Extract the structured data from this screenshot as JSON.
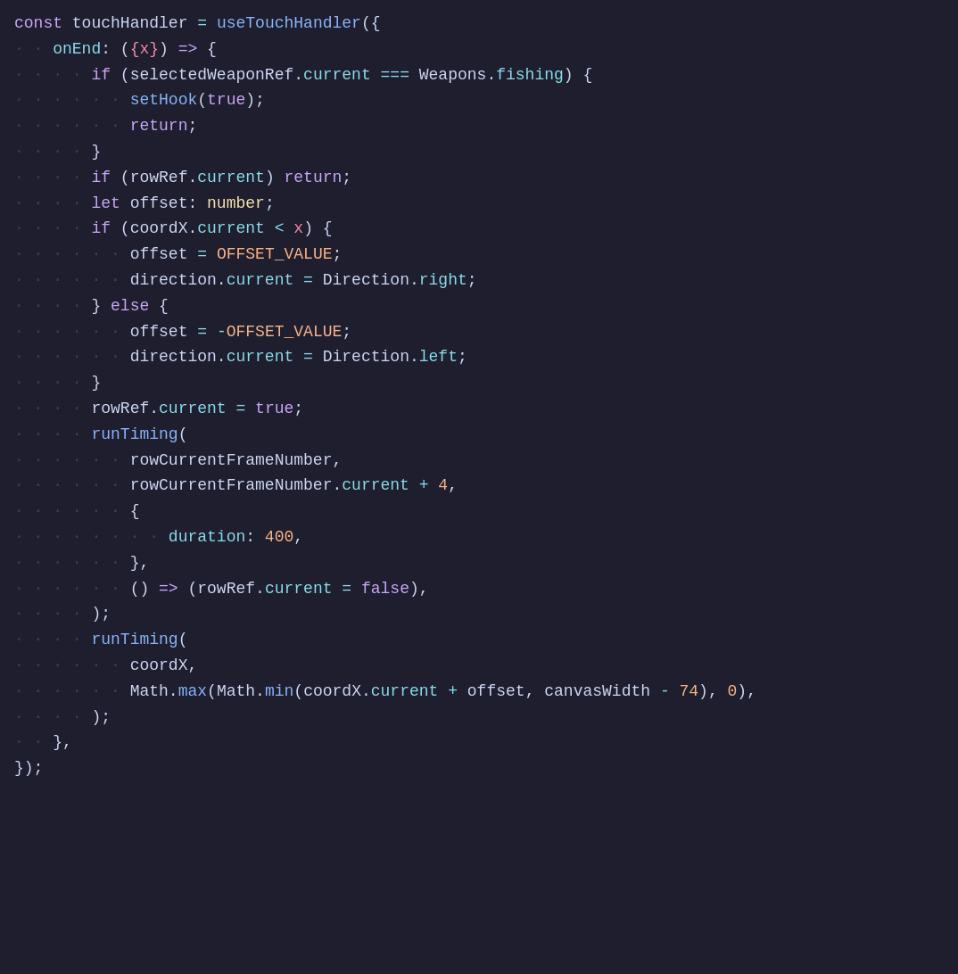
{
  "editor": {
    "background": "#1e1e2e",
    "lines": [
      {
        "indent": 0,
        "tokens": [
          {
            "t": "kw",
            "v": "const"
          },
          {
            "t": "var",
            "v": " touchHandler "
          },
          {
            "t": "eq",
            "v": "="
          },
          {
            "t": "var",
            "v": " "
          },
          {
            "t": "fn",
            "v": "useTouchHandler"
          },
          {
            "t": "punc",
            "v": "({"
          }
        ]
      },
      {
        "indent": 1,
        "tokens": [
          {
            "t": "obj-key",
            "v": "onEnd"
          },
          {
            "t": "punc",
            "v": ": ("
          },
          {
            "t": "param",
            "v": "{x}"
          },
          {
            "t": "punc",
            "v": ") "
          },
          {
            "t": "arrow",
            "v": "=>"
          },
          {
            "t": "punc",
            "v": " {"
          }
        ]
      },
      {
        "indent": 2,
        "tokens": [
          {
            "t": "kw",
            "v": "if"
          },
          {
            "t": "punc",
            "v": " ("
          },
          {
            "t": "var",
            "v": "selectedWeaponRef"
          },
          {
            "t": "punc",
            "v": "."
          },
          {
            "t": "prop",
            "v": "current"
          },
          {
            "t": "punc",
            "v": " "
          },
          {
            "t": "op",
            "v": "==="
          },
          {
            "t": "punc",
            "v": " "
          },
          {
            "t": "var",
            "v": "Weapons"
          },
          {
            "t": "punc",
            "v": "."
          },
          {
            "t": "prop",
            "v": "fishing"
          },
          {
            "t": "punc",
            "v": ") {"
          }
        ]
      },
      {
        "indent": 3,
        "tokens": [
          {
            "t": "fn",
            "v": "setHook"
          },
          {
            "t": "punc",
            "v": "("
          },
          {
            "t": "bool-val",
            "v": "true"
          },
          {
            "t": "punc",
            "v": ");"
          }
        ]
      },
      {
        "indent": 3,
        "tokens": [
          {
            "t": "kw",
            "v": "return"
          },
          {
            "t": "punc",
            "v": ";"
          }
        ]
      },
      {
        "indent": 2,
        "tokens": [
          {
            "t": "punc",
            "v": "}"
          }
        ]
      },
      {
        "indent": 2,
        "tokens": [
          {
            "t": "kw",
            "v": "if"
          },
          {
            "t": "punc",
            "v": " ("
          },
          {
            "t": "var",
            "v": "rowRef"
          },
          {
            "t": "punc",
            "v": "."
          },
          {
            "t": "prop",
            "v": "current"
          },
          {
            "t": "punc",
            "v": ") "
          },
          {
            "t": "kw",
            "v": "return"
          },
          {
            "t": "punc",
            "v": ";"
          }
        ]
      },
      {
        "indent": 2,
        "tokens": [
          {
            "t": "kw",
            "v": "let"
          },
          {
            "t": "var",
            "v": " offset"
          },
          {
            "t": "punc",
            "v": ": "
          },
          {
            "t": "type",
            "v": "number"
          },
          {
            "t": "punc",
            "v": ";"
          }
        ]
      },
      {
        "indent": 2,
        "tokens": [
          {
            "t": "kw",
            "v": "if"
          },
          {
            "t": "punc",
            "v": " ("
          },
          {
            "t": "var",
            "v": "coordX"
          },
          {
            "t": "punc",
            "v": "."
          },
          {
            "t": "prop",
            "v": "current"
          },
          {
            "t": "punc",
            "v": " "
          },
          {
            "t": "op",
            "v": "<"
          },
          {
            "t": "punc",
            "v": " "
          },
          {
            "t": "param",
            "v": "x"
          },
          {
            "t": "punc",
            "v": ") {"
          }
        ]
      },
      {
        "indent": 3,
        "tokens": [
          {
            "t": "var",
            "v": "offset"
          },
          {
            "t": "punc",
            "v": " "
          },
          {
            "t": "eq",
            "v": "="
          },
          {
            "t": "punc",
            "v": " "
          },
          {
            "t": "const-val",
            "v": "OFFSET_VALUE"
          },
          {
            "t": "punc",
            "v": ";"
          }
        ]
      },
      {
        "indent": 3,
        "tokens": [
          {
            "t": "var",
            "v": "direction"
          },
          {
            "t": "punc",
            "v": "."
          },
          {
            "t": "prop",
            "v": "current"
          },
          {
            "t": "punc",
            "v": " "
          },
          {
            "t": "eq",
            "v": "="
          },
          {
            "t": "punc",
            "v": " "
          },
          {
            "t": "var",
            "v": "Direction"
          },
          {
            "t": "punc",
            "v": "."
          },
          {
            "t": "prop",
            "v": "right"
          },
          {
            "t": "punc",
            "v": ";"
          }
        ]
      },
      {
        "indent": 2,
        "tokens": [
          {
            "t": "punc",
            "v": "} "
          },
          {
            "t": "kw",
            "v": "else"
          },
          {
            "t": "punc",
            "v": " {"
          }
        ]
      },
      {
        "indent": 3,
        "tokens": [
          {
            "t": "var",
            "v": "offset"
          },
          {
            "t": "punc",
            "v": " "
          },
          {
            "t": "eq",
            "v": "="
          },
          {
            "t": "punc",
            "v": " "
          },
          {
            "t": "op",
            "v": "-"
          },
          {
            "t": "const-val",
            "v": "OFFSET_VALUE"
          },
          {
            "t": "punc",
            "v": ";"
          }
        ]
      },
      {
        "indent": 3,
        "tokens": [
          {
            "t": "var",
            "v": "direction"
          },
          {
            "t": "punc",
            "v": "."
          },
          {
            "t": "prop",
            "v": "current"
          },
          {
            "t": "punc",
            "v": " "
          },
          {
            "t": "eq",
            "v": "="
          },
          {
            "t": "punc",
            "v": " "
          },
          {
            "t": "var",
            "v": "Direction"
          },
          {
            "t": "punc",
            "v": "."
          },
          {
            "t": "prop",
            "v": "left"
          },
          {
            "t": "punc",
            "v": ";"
          }
        ]
      },
      {
        "indent": 2,
        "tokens": [
          {
            "t": "punc",
            "v": "}"
          }
        ]
      },
      {
        "indent": 2,
        "tokens": [
          {
            "t": "var",
            "v": "rowRef"
          },
          {
            "t": "punc",
            "v": "."
          },
          {
            "t": "prop",
            "v": "current"
          },
          {
            "t": "punc",
            "v": " "
          },
          {
            "t": "eq",
            "v": "="
          },
          {
            "t": "punc",
            "v": " "
          },
          {
            "t": "bool-val",
            "v": "true"
          },
          {
            "t": "punc",
            "v": ";"
          }
        ]
      },
      {
        "indent": 2,
        "tokens": [
          {
            "t": "fn",
            "v": "runTiming"
          },
          {
            "t": "punc",
            "v": "("
          }
        ]
      },
      {
        "indent": 3,
        "tokens": [
          {
            "t": "var",
            "v": "rowCurrentFrameNumber"
          },
          {
            "t": "punc",
            "v": ","
          }
        ]
      },
      {
        "indent": 3,
        "tokens": [
          {
            "t": "var",
            "v": "rowCurrentFrameNumber"
          },
          {
            "t": "punc",
            "v": "."
          },
          {
            "t": "prop",
            "v": "current"
          },
          {
            "t": "punc",
            "v": " "
          },
          {
            "t": "op",
            "v": "+"
          },
          {
            "t": "punc",
            "v": " "
          },
          {
            "t": "num",
            "v": "4"
          },
          {
            "t": "punc",
            "v": ","
          }
        ]
      },
      {
        "indent": 3,
        "tokens": [
          {
            "t": "punc",
            "v": "{"
          }
        ]
      },
      {
        "indent": 4,
        "tokens": [
          {
            "t": "obj-key",
            "v": "duration"
          },
          {
            "t": "punc",
            "v": ": "
          },
          {
            "t": "num",
            "v": "400"
          },
          {
            "t": "punc",
            "v": ","
          }
        ]
      },
      {
        "indent": 3,
        "tokens": [
          {
            "t": "punc",
            "v": "},"
          }
        ]
      },
      {
        "indent": 3,
        "tokens": [
          {
            "t": "punc",
            "v": "() "
          },
          {
            "t": "arrow",
            "v": "=>"
          },
          {
            "t": "punc",
            "v": " ("
          },
          {
            "t": "var",
            "v": "rowRef"
          },
          {
            "t": "punc",
            "v": "."
          },
          {
            "t": "prop",
            "v": "current"
          },
          {
            "t": "punc",
            "v": " "
          },
          {
            "t": "eq",
            "v": "="
          },
          {
            "t": "punc",
            "v": " "
          },
          {
            "t": "bool-val",
            "v": "false"
          },
          {
            "t": "punc",
            "v": "),"
          }
        ]
      },
      {
        "indent": 2,
        "tokens": [
          {
            "t": "punc",
            "v": ");"
          }
        ]
      },
      {
        "indent": 2,
        "tokens": [
          {
            "t": "fn",
            "v": "runTiming"
          },
          {
            "t": "punc",
            "v": "("
          }
        ]
      },
      {
        "indent": 3,
        "tokens": [
          {
            "t": "var",
            "v": "coordX"
          },
          {
            "t": "punc",
            "v": ","
          }
        ]
      },
      {
        "indent": 3,
        "tokens": [
          {
            "t": "var",
            "v": "Math"
          },
          {
            "t": "punc",
            "v": "."
          },
          {
            "t": "method",
            "v": "max"
          },
          {
            "t": "punc",
            "v": "("
          },
          {
            "t": "var",
            "v": "Math"
          },
          {
            "t": "punc",
            "v": "."
          },
          {
            "t": "method",
            "v": "min"
          },
          {
            "t": "punc",
            "v": "("
          },
          {
            "t": "var",
            "v": "coordX"
          },
          {
            "t": "punc",
            "v": "."
          },
          {
            "t": "prop",
            "v": "current"
          },
          {
            "t": "punc",
            "v": " "
          },
          {
            "t": "op",
            "v": "+"
          },
          {
            "t": "punc",
            "v": " "
          },
          {
            "t": "var",
            "v": "offset"
          },
          {
            "t": "punc",
            "v": ", "
          },
          {
            "t": "var",
            "v": "canvasWidth"
          },
          {
            "t": "punc",
            "v": " "
          },
          {
            "t": "op",
            "v": "-"
          },
          {
            "t": "punc",
            "v": " "
          },
          {
            "t": "num",
            "v": "74"
          },
          {
            "t": "punc",
            "v": "), "
          },
          {
            "t": "num",
            "v": "0"
          },
          {
            "t": "punc",
            "v": "),"
          }
        ]
      },
      {
        "indent": 2,
        "tokens": [
          {
            "t": "punc",
            "v": ");"
          }
        ]
      },
      {
        "indent": 1,
        "tokens": [
          {
            "t": "punc",
            "v": "},"
          }
        ]
      },
      {
        "indent": 0,
        "tokens": [
          {
            "t": "punc",
            "v": "});"
          }
        ]
      }
    ]
  }
}
